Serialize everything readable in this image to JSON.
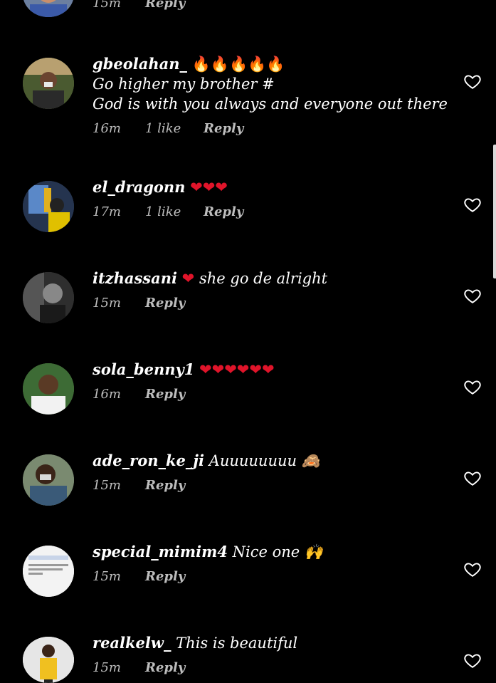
{
  "top_partial": {
    "time": "15m",
    "reply": "Reply"
  },
  "comments": [
    {
      "username": "gbeolahan_",
      "emoji": "🔥🔥🔥🔥🔥",
      "text": "",
      "lines": [
        "Go higher my brother #",
        "God is with you always and everyone out there"
      ],
      "time": "16m",
      "likes": "1 like",
      "reply": "Reply"
    },
    {
      "username": "el_dragonn",
      "emoji": "❤❤❤",
      "text": "",
      "lines": [],
      "time": "17m",
      "likes": "1 like",
      "reply": "Reply"
    },
    {
      "username": "itzhassani",
      "emoji": "❤",
      "text": "she go de alright",
      "lines": [],
      "time": "15m",
      "likes": "",
      "reply": "Reply"
    },
    {
      "username": "sola_benny1",
      "emoji": "❤❤❤❤❤❤",
      "text": "",
      "lines": [],
      "time": "16m",
      "likes": "",
      "reply": "Reply"
    },
    {
      "username": "ade_ron_ke_ji",
      "emoji": "",
      "text": "Auuuuuuuu 🙈",
      "lines": [],
      "time": "15m",
      "likes": "",
      "reply": "Reply"
    },
    {
      "username": "special_mimim4",
      "emoji": "",
      "text": "Nice one 🙌",
      "lines": [],
      "time": "15m",
      "likes": "",
      "reply": "Reply"
    },
    {
      "username": "realkelw_",
      "emoji": "",
      "text": "This is beautiful",
      "lines": [],
      "time": "15m",
      "likes": "",
      "reply": "Reply"
    }
  ],
  "colors": {
    "background": "#000000",
    "text": "#ffffff",
    "meta": "#bdbdbd",
    "heart_emoji": "#e0142a",
    "fire": "#ff7a00"
  },
  "icons": {
    "like": "heart-outline-icon"
  }
}
